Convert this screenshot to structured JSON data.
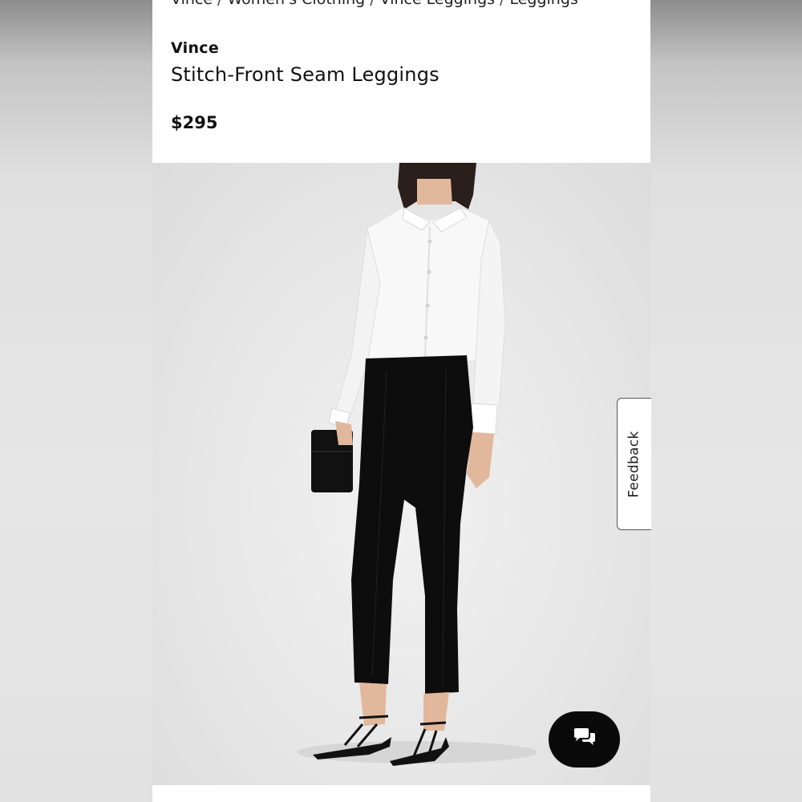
{
  "breadcrumb": {
    "items": [
      "Vince",
      "Women's Clothing",
      "Vince Leggings",
      "Leggings"
    ],
    "separator": "/"
  },
  "product": {
    "brand": "Vince",
    "name": "Stitch-Front Seam Leggings",
    "price": "$295"
  },
  "image": {
    "alt": "Model wearing white button-up shirt with black stitch-front seam leggings, black clutch and black strappy sandals"
  },
  "feedback": {
    "label": "Feedback"
  },
  "chat": {
    "icon": "chat-bubbles-icon"
  },
  "colors": {
    "background_dark": "#8d8d8d",
    "background_light": "#e6e6e6",
    "page": "#ffffff",
    "text": "#111111",
    "chat_button": "#0a0a0a"
  }
}
